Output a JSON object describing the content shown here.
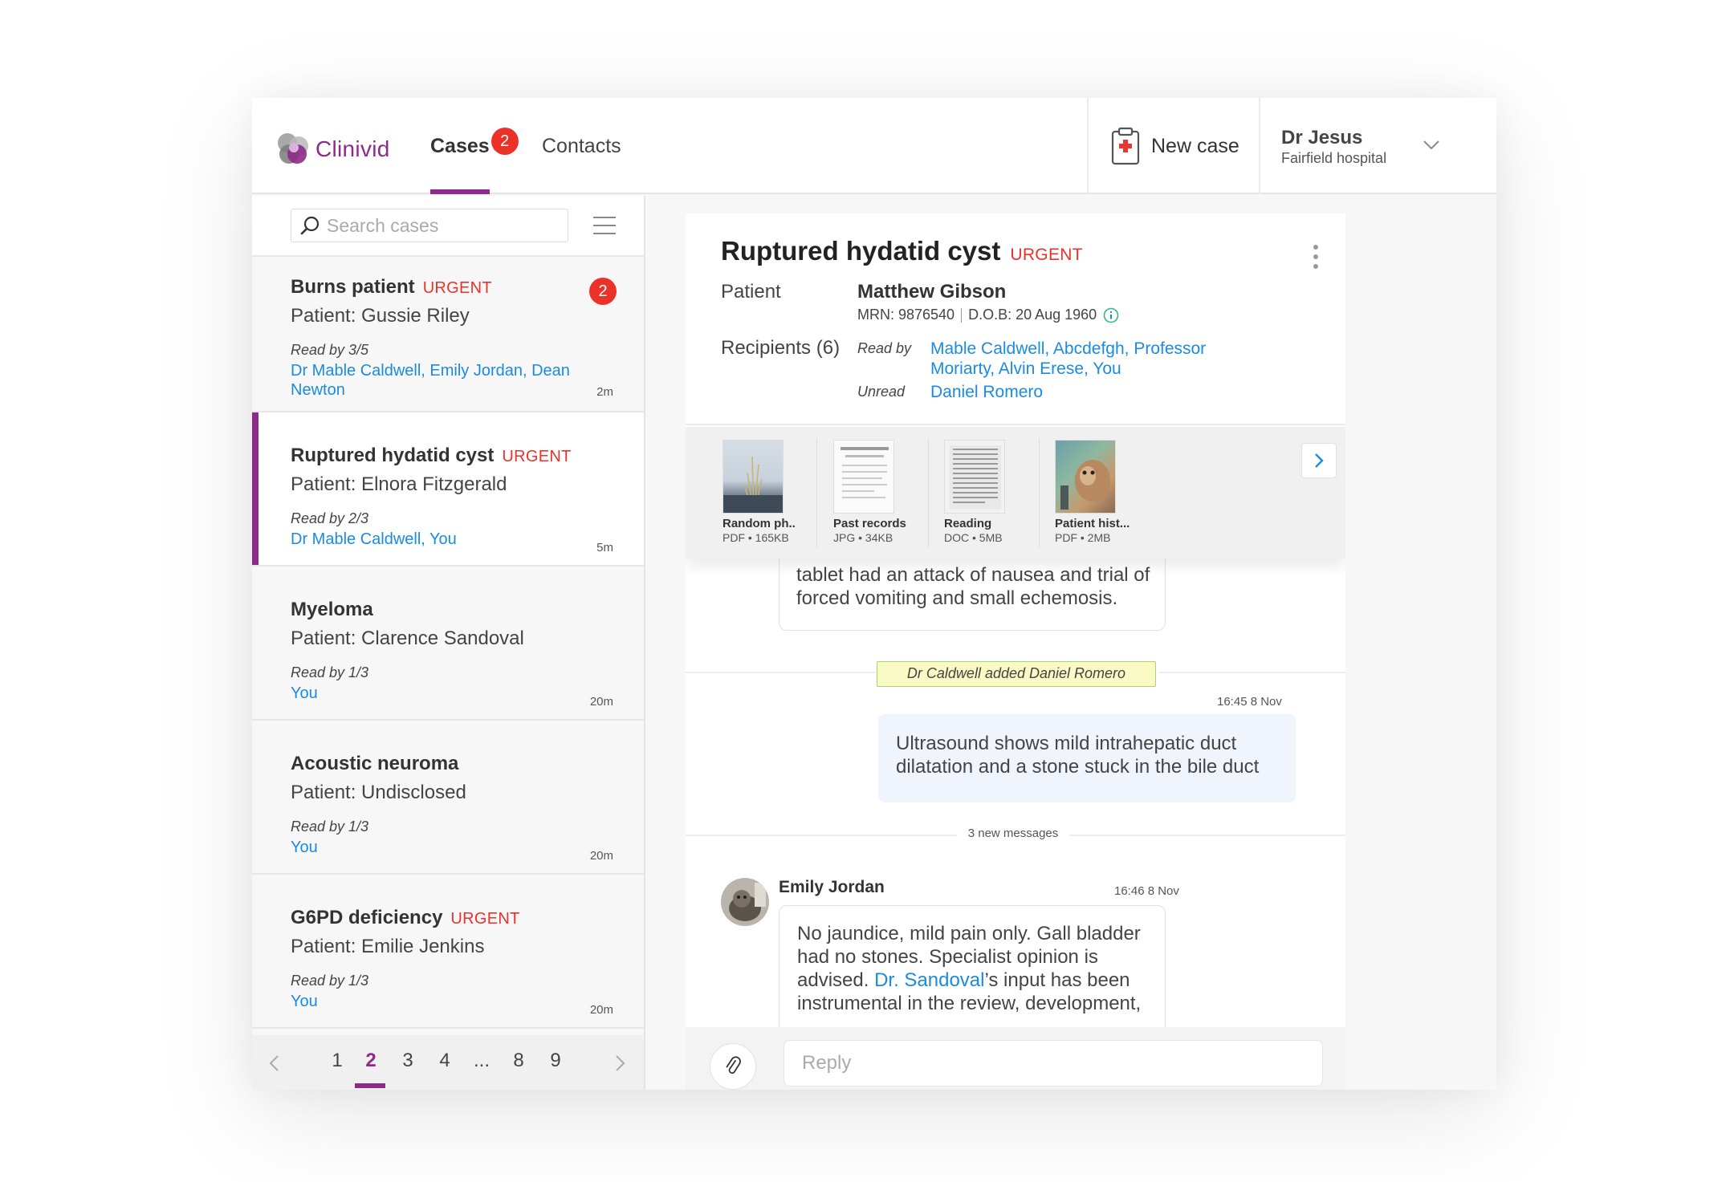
{
  "brand": {
    "name": "Clinivid",
    "accent": "#8e2a8b",
    "urgent_color": "#ea3229",
    "link_color": "#1a8be0"
  },
  "nav": {
    "tabs": [
      {
        "label": "Cases",
        "badge": "2",
        "active": true
      },
      {
        "label": "Contacts",
        "active": false
      }
    ],
    "new_case_label": "New case",
    "new_case_icon": "clipboard-medical-icon",
    "user": {
      "name": "Dr Jesus",
      "hospital": "Fairfield hospital"
    }
  },
  "search": {
    "placeholder": "Search cases",
    "value": ""
  },
  "cases": [
    {
      "title": "Burns patient",
      "urgent": "URGENT",
      "patient": "Patient: Gussie Riley",
      "read": "Read by 3/5",
      "readers": "Dr Mable Caldwell, Emily Jordan, Dean Newton",
      "time": "2m",
      "badge": "2"
    },
    {
      "title": "Ruptured hydatid cyst",
      "urgent": "URGENT",
      "patient": "Patient: Elnora Fitzgerald",
      "read": "Read by 2/3",
      "readers": "Dr Mable Caldwell, You",
      "time": "5m",
      "selected": true
    },
    {
      "title": "Myeloma",
      "urgent": "",
      "patient": "Patient: Clarence Sandoval",
      "read": "Read by 1/3",
      "readers": "You",
      "time": "20m"
    },
    {
      "title": "Acoustic neuroma",
      "urgent": "",
      "patient": "Patient: Undisclosed",
      "read": "Read by 1/3",
      "readers": "You",
      "time": "20m"
    },
    {
      "title": "G6PD deficiency",
      "urgent": "URGENT",
      "patient": "Patient: Emilie Jenkins",
      "read": "Read by 1/3",
      "readers": "You",
      "time": "20m"
    }
  ],
  "pagination": {
    "pages": [
      "1",
      "2",
      "3",
      "4",
      "...",
      "8",
      "9"
    ],
    "current": "2"
  },
  "detail": {
    "title": "Ruptured hydatid cyst",
    "urgent": "URGENT",
    "patient_label": "Patient",
    "patient_name": "Matthew Gibson",
    "mrn": "MRN: 9876540",
    "dob": "D.O.B: 20 Aug 1960",
    "recipients_label": "Recipients (6)",
    "read_by_label": "Read by",
    "read_by": "Mable Caldwell, Abcdefgh, Professor Moriarty, Alvin Erese, You",
    "unread_label": "Unread",
    "unread": "Daniel Romero"
  },
  "attachments": [
    {
      "name": "Random ph..",
      "meta": "PDF • 165KB"
    },
    {
      "name": "Past records",
      "meta": "JPG • 34KB"
    },
    {
      "name": "Reading",
      "meta": "DOC • 5MB"
    },
    {
      "name": "Patient hist...",
      "meta": "PDF • 2MB"
    }
  ],
  "conversation": {
    "previous_text": "tablet had an attack of nausea and trial of forced vomiting and small echemosis.",
    "system_note": "Dr Caldwell added Daniel Romero",
    "outgoing": {
      "time": "16:45 8 Nov",
      "text": "Ultrasound shows mild intrahepatic duct dilatation and a stone stuck in the bile duct"
    },
    "new_messages": "3 new messages",
    "incoming": {
      "sender": "Emily Jordan",
      "time": "16:46 8 Nov",
      "text_before": "No jaundice, mild pain only. Gall bladder had no stones. Specialist opinion is advised. ",
      "link": "Dr. Sandoval",
      "text_after": "’s input has been instrumental in the review, development,"
    }
  },
  "reply": {
    "placeholder": "Reply",
    "value": ""
  }
}
